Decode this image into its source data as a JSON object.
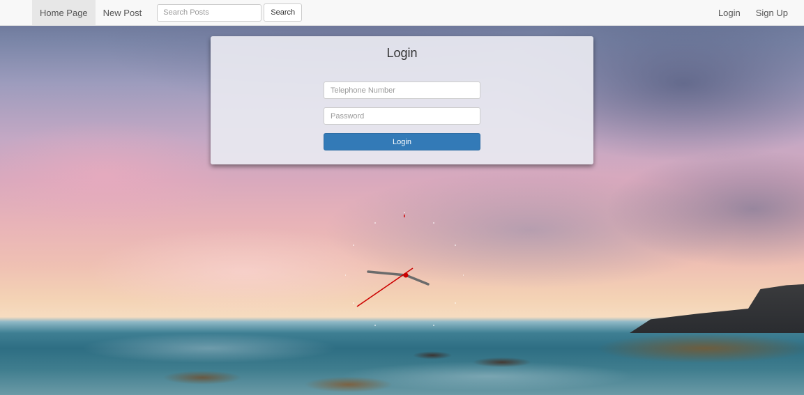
{
  "navbar": {
    "links": [
      {
        "label": "Home Page",
        "active": true
      },
      {
        "label": "New Post",
        "active": false
      }
    ],
    "search": {
      "placeholder": "Search Posts",
      "value": "",
      "button_label": "Search"
    },
    "right_links": [
      {
        "label": "Login"
      },
      {
        "label": "Sign Up"
      }
    ]
  },
  "login_panel": {
    "title": "Login",
    "phone_placeholder": "Telephone Number",
    "password_placeholder": "Password",
    "submit_label": "Login"
  },
  "colors": {
    "primary_button": "#337ab7",
    "navbar_bg": "#f8f8f8",
    "active_tab_bg": "#e7e7e7",
    "clock_hands": "#666666",
    "clock_second_hand": "#cc0000"
  },
  "background": {
    "scene": "sunset-seascape",
    "clock_widget": "analog-clock"
  }
}
